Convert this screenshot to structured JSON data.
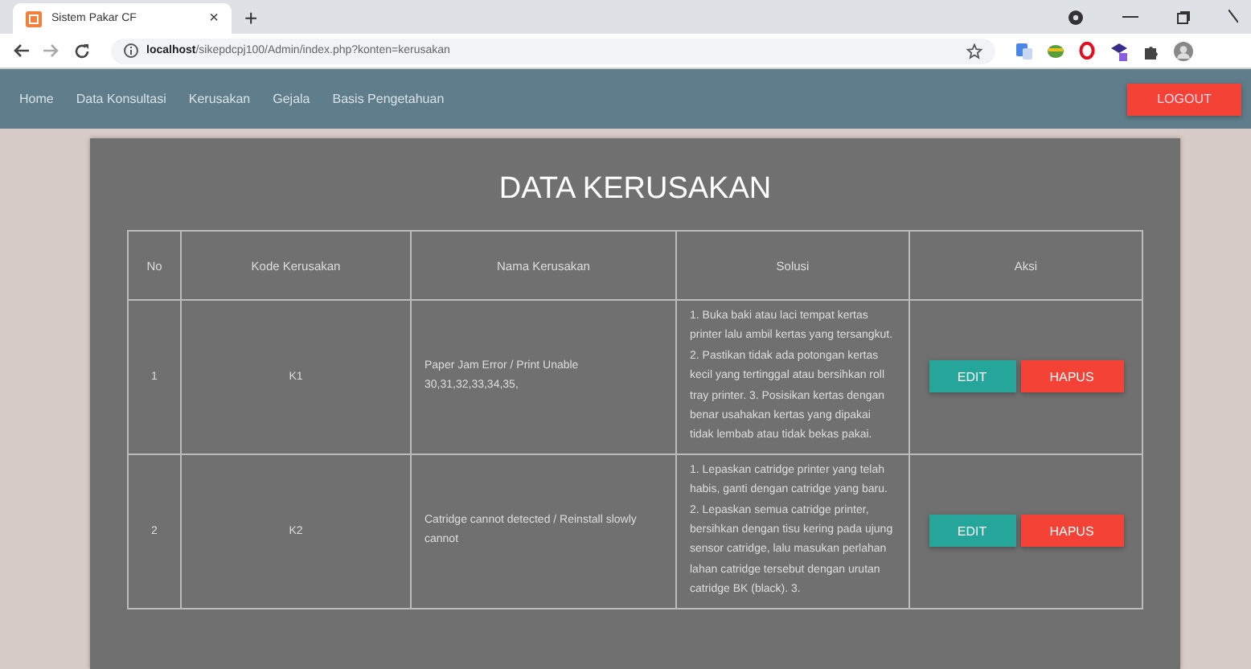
{
  "browser": {
    "tab_title": "Sistem Pakar CF",
    "tab_close": "×",
    "new_tab": "+",
    "url_host": "localhost",
    "url_path": "/sikepdcpj100/Admin/index.php?konten=kerusakan"
  },
  "nav": {
    "items": [
      {
        "label": "Home"
      },
      {
        "label": "Data Konsultasi"
      },
      {
        "label": "Kerusakan"
      },
      {
        "label": "Gejala"
      },
      {
        "label": "Basis Pengetahuan"
      }
    ],
    "logout": "LOGOUT"
  },
  "title": "DATA KERUSAKAN",
  "table": {
    "columns": [
      "No",
      "Kode Kerusakan",
      "Nama Kerusakan",
      "Solusi",
      "Aksi"
    ],
    "rows": [
      {
        "no": "1",
        "kode": "K1",
        "nama": "Paper Jam Error / Print Unable 30,31,32,33,34,35,",
        "solusi": "1. Buka baki atau laci tempat kertas printer lalu ambil kertas yang tersangkut. 2. Pastikan tidak ada potongan kertas kecil yang tertinggal atau bersihkan roll tray printer. 3. Posisikan kertas dengan benar usahakan kertas yang dipakai tidak lembab atau tidak bekas pakai.",
        "edit": "EDIT",
        "hapus": "HAPUS"
      },
      {
        "no": "2",
        "kode": "K2",
        "nama": "Catridge cannot detected / Reinstall slowly cannot",
        "solusi": "1. Lepaskan catridge printer yang telah habis, ganti dengan catridge yang baru. 2. Lepaskan semua catridge printer, bersihkan dengan tisu kering pada ujung sensor catridge, lalu masukan perlahan lahan catridge tersebut dengan urutan catridge BK (black). 3.",
        "edit": "EDIT",
        "hapus": "HAPUS"
      }
    ]
  }
}
